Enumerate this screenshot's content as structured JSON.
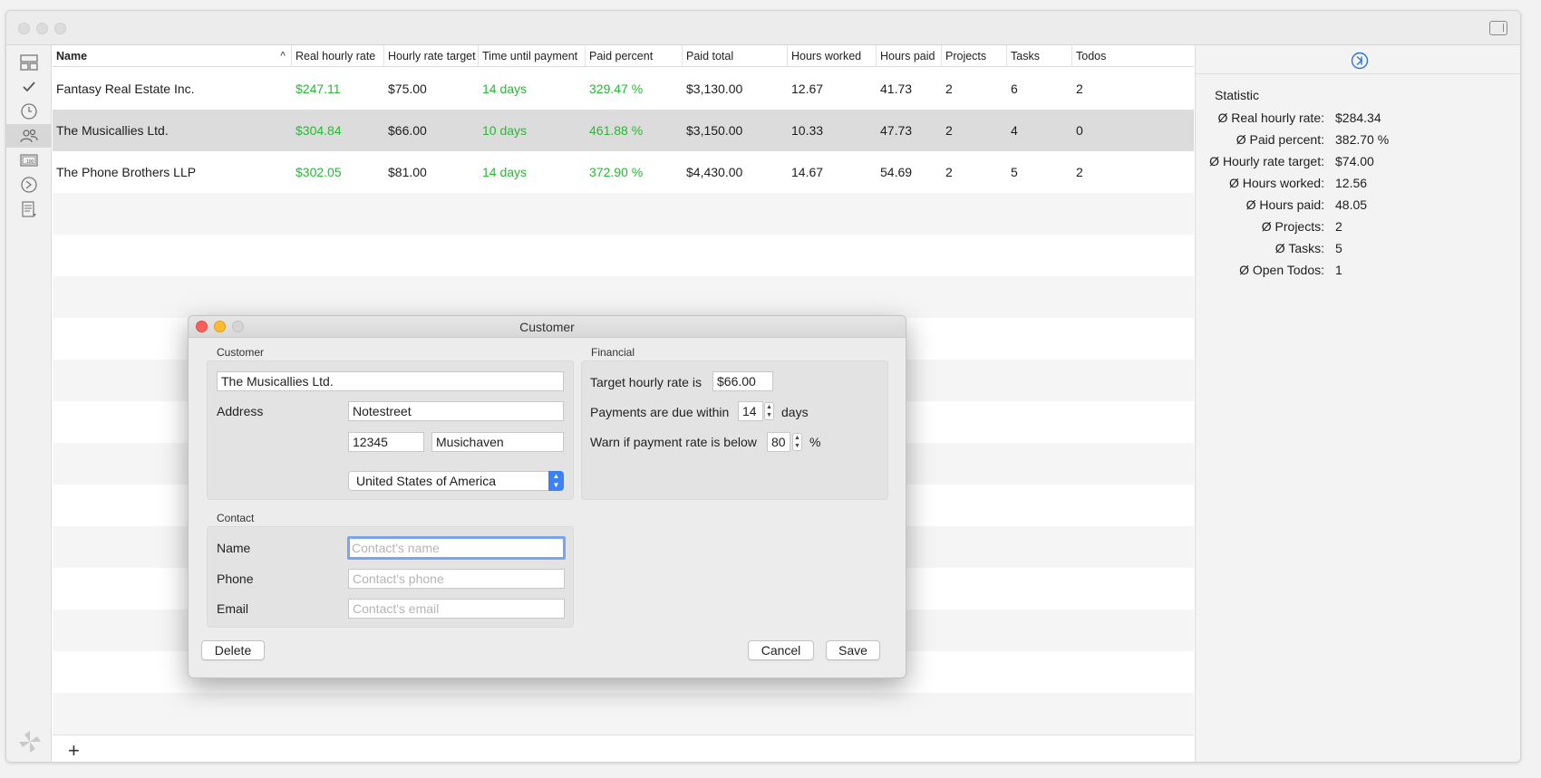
{
  "table": {
    "columns": [
      "Name",
      "Real hourly rate",
      "Hourly rate target",
      "Time until payment",
      "Paid percent",
      "Paid total",
      "Hours worked",
      "Hours paid",
      "Projects",
      "Tasks",
      "Todos"
    ],
    "rows": [
      {
        "name": "Fantasy Real Estate Inc.",
        "real_rate": "$247.11",
        "target": "$75.00",
        "time_until": "14 days",
        "paid_percent": "329.47 %",
        "paid_total": "$3,130.00",
        "hours_worked": "12.67",
        "hours_paid": "41.73",
        "projects": "2",
        "tasks": "6",
        "todos": "2"
      },
      {
        "name": "The Musicallies Ltd.",
        "real_rate": "$304.84",
        "target": "$66.00",
        "time_until": "10 days",
        "paid_percent": "461.88 %",
        "paid_total": "$3,150.00",
        "hours_worked": "10.33",
        "hours_paid": "47.73",
        "projects": "2",
        "tasks": "4",
        "todos": "0"
      },
      {
        "name": "The Phone Brothers LLP",
        "real_rate": "$302.05",
        "target": "$81.00",
        "time_until": "14 days",
        "paid_percent": "372.90 %",
        "paid_total": "$4,430.00",
        "hours_worked": "14.67",
        "hours_paid": "54.69",
        "projects": "2",
        "tasks": "5",
        "todos": "2"
      }
    ],
    "add_label": "+"
  },
  "stats": {
    "title": "Statistic",
    "items": [
      {
        "label": "Ø Real hourly rate:",
        "value": "$284.34"
      },
      {
        "label": "Ø Paid percent:",
        "value": "382.70 %"
      },
      {
        "label": "Ø Hourly rate target:",
        "value": "$74.00"
      },
      {
        "label": "Ø Hours worked:",
        "value": "12.56"
      },
      {
        "label": "Ø Hours paid:",
        "value": "48.05"
      },
      {
        "label": "Ø Projects:",
        "value": "2"
      },
      {
        "label": "Ø Tasks:",
        "value": "5"
      },
      {
        "label": "Ø Open Todos:",
        "value": "1"
      }
    ]
  },
  "dialog": {
    "title": "Customer",
    "customer_group": "Customer",
    "customer_name": "The Musicallies Ltd.",
    "address_label": "Address",
    "street": "Notestreet",
    "zip": "12345",
    "city": "Musichaven",
    "country": "United States of America",
    "contact_group": "Contact",
    "name_label": "Name",
    "name_placeholder": "Contact's name",
    "phone_label": "Phone",
    "phone_placeholder": "Contact's phone",
    "email_label": "Email",
    "email_placeholder": "Contact's email",
    "financial_group": "Financial",
    "target_rate_label": "Target hourly rate is",
    "target_rate": "$66.00",
    "due_label": "Payments are due within",
    "due_value": "14",
    "due_unit": "days",
    "warn_label": "Warn if payment rate is below",
    "warn_value": "80",
    "warn_unit": "%",
    "delete_label": "Delete",
    "cancel_label": "Cancel",
    "save_label": "Save"
  },
  "colors": {
    "positive": "#28b834",
    "selection": "#dcdcdc",
    "accent": "#3b82f6",
    "close": "#fc5f57",
    "minimize": "#fdbc2e"
  },
  "icons": {
    "sidebar": [
      "dashboard-icon",
      "checkmark-icon",
      "clock-icon",
      "customers-icon",
      "invoice-icon",
      "reports-icon",
      "document-icon"
    ],
    "app_logo": "pinwheel-icon",
    "stats_toggle": "collapse-arrow-icon"
  }
}
